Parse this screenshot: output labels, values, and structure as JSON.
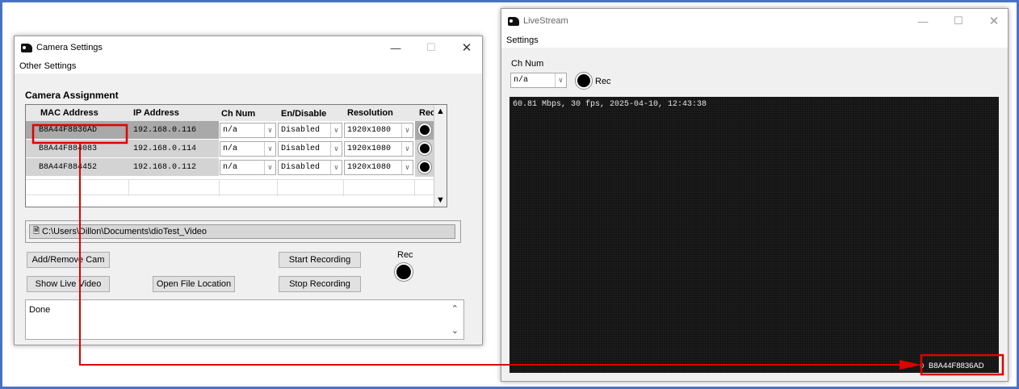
{
  "camera_settings": {
    "title": "Camera Settings",
    "menu": "Other Settings",
    "section_title": "Camera Assignment",
    "columns": [
      "MAC Address",
      "IP Address",
      "Ch Num",
      "En/Disable",
      "Resolution",
      "Rec"
    ],
    "rows": [
      {
        "mac": "B8A44F8836AD",
        "ip": "192.168.0.116",
        "ch": "n/a",
        "en": "Disabled",
        "res": "1920x1080"
      },
      {
        "mac": "B8A44F884083",
        "ip": "192.168.0.114",
        "ch": "n/a",
        "en": "Disabled",
        "res": "1920x1080"
      },
      {
        "mac": "B8A44F884452",
        "ip": "192.168.0.112",
        "ch": "n/a",
        "en": "Disabled",
        "res": "1920x1080"
      }
    ],
    "file_path": "C:\\Users\\Dillon\\Documents\\dioTest_Video",
    "buttons": {
      "add_remove": "Add/Remove Cam",
      "show_live": "Show Live Video",
      "open_file": "Open File Location",
      "start": "Start Recording",
      "stop": "Stop Recording"
    },
    "rec_label": "Rec",
    "log_text": "Done"
  },
  "livestream": {
    "title": "LiveStream",
    "menu": "Settings",
    "ch_num_label": "Ch Num",
    "ch_value": "n/a",
    "rec_label": "Rec",
    "overlay_text": "60.81 Mbps, 30 fps, 2025-04-10, 12:43:38",
    "mac_label": "B8A44F8836AD",
    "mac_prefix": "0"
  },
  "colors": {
    "highlight": "#e00000",
    "frame_border": "#4a72c4",
    "video_bg": "#141414"
  }
}
